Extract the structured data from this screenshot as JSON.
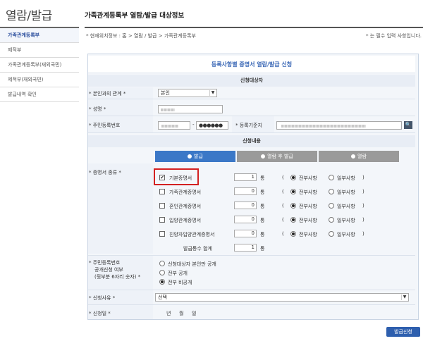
{
  "sidebar": {
    "title": "열람/발급",
    "items": [
      {
        "label": "가족관계등록부"
      },
      {
        "label": "제적부"
      },
      {
        "label": "가족관계등록부(재외국민)"
      },
      {
        "label": "제적부(재외국민)"
      },
      {
        "label": "발급내역 확인"
      }
    ]
  },
  "header": {
    "title": "가족관계등록부 열람/발급 대상정보",
    "breadcrumb": "* 현재위치정보 : 홈 > 열람 / 발급 > 가족관계등록부",
    "required_note": "* 는 필수 입력 사항입니다."
  },
  "form": {
    "heading": "등록사항별 증명서 열람/발급 신청",
    "section_applicant": "신청대상자",
    "relation_label": "* 본인과의 관계 *",
    "relation_value": "본인",
    "name_label": "* 성명 *",
    "rrn_label": "* 주민등록번호",
    "rrn_dash": "-",
    "rrn_masked": "●●●●●●",
    "reg_base_label": "* 등록기준지",
    "search_icon": "🔍",
    "section_content": "신청내용",
    "tabs": [
      {
        "label": "발급"
      },
      {
        "label": "열람 후 발급"
      },
      {
        "label": "열람"
      }
    ],
    "cert_type_label": "* 증명서 종류 *",
    "count_unit": "통",
    "paren_open": "(",
    "paren_close": ")",
    "opt_all": "전부사항",
    "opt_part": "일부사항",
    "certs": [
      {
        "name": "기본증명서",
        "checked": "✔",
        "count": "1"
      },
      {
        "name": "가족관계증명서",
        "checked": "",
        "count": "0"
      },
      {
        "name": "혼인관계증명서",
        "checked": "",
        "count": "0"
      },
      {
        "name": "입양관계증명서",
        "checked": "",
        "count": "0"
      },
      {
        "name": "친양자입양관계증명서",
        "checked": "",
        "count": "0"
      }
    ],
    "total_label": "발급통수 합계",
    "total_value": "1",
    "disclosure_label_1": "* 주민등록번호",
    "disclosure_label_2": "공개신청 여부",
    "disclosure_label_3": "(뒷부분 6자리 숫자) *",
    "disclosure_options": [
      {
        "label": "신청대상자 본인만 공개"
      },
      {
        "label": "전부 공개"
      },
      {
        "label": "전부 비공개"
      }
    ],
    "reason_label": "* 신청사유 *",
    "reason_value": "선택",
    "date_label": "* 신청일 *",
    "date_year": "년",
    "date_month": "월",
    "date_day": "일",
    "select_arrow": "▼",
    "submit_label": "발급신청"
  },
  "colors": {
    "accent_blue": "#3b78c7",
    "highlight_red": "#d32020",
    "submit_blue": "#2e5fae"
  }
}
